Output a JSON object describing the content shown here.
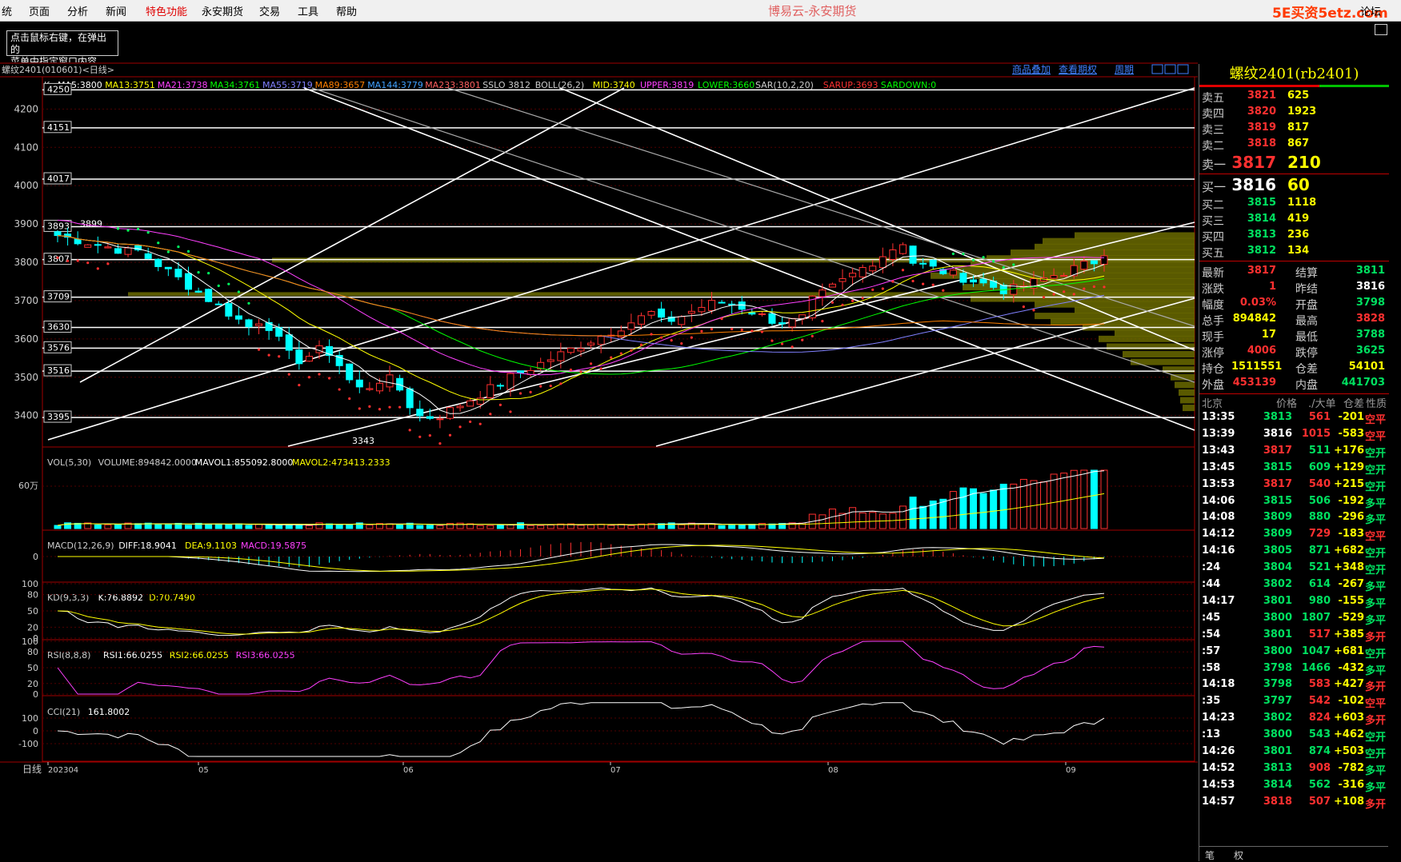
{
  "menu": {
    "items": [
      "统",
      "页面",
      "分析",
      "新闻",
      "特色功能",
      "永安期货",
      "交易",
      "工具",
      "帮助"
    ],
    "app_title": "博易云-永安期货",
    "logo_text": "5E买资5etz.com",
    "forum_text": "论坛"
  },
  "hint": {
    "line1": "点击鼠标右键，在弹出的",
    "line2": "菜单中指定窗口内容。"
  },
  "chart_header": {
    "symbol_label": "螺纹2401(010601)<日线>",
    "links": [
      "商品叠加",
      "查看期权",
      "周期"
    ],
    "indicator_prefix": "K",
    "indicators": [
      {
        "text": "MA5:3800",
        "color": "#ffffff"
      },
      {
        "text": "MA13:3751",
        "color": "#ffff00"
      },
      {
        "text": "MA21:3738",
        "color": "#ff40ff"
      },
      {
        "text": "MA34:3761",
        "color": "#00ff00"
      },
      {
        "text": "MA55:3719",
        "color": "#8080ff"
      },
      {
        "text": "MA89:3657",
        "color": "#ff8000"
      },
      {
        "text": "MA144:3779",
        "color": "#40a0ff"
      },
      {
        "text": "MA233:3801",
        "color": "#ff6060"
      },
      {
        "text": "SSLO 3812",
        "color": "#cccccc"
      },
      {
        "text": "BOLL(26,2)",
        "color": "#cccccc"
      },
      {
        "text": "MID:3740",
        "color": "#ffff00"
      },
      {
        "text": "UPPER:3819",
        "color": "#ff40ff"
      },
      {
        "text": "LOWER:3660",
        "color": "#00ff00"
      },
      {
        "text": "SAR(10,2,20)",
        "color": "#cccccc"
      },
      {
        "text": "SARUP:3693",
        "color": "#ff3030"
      },
      {
        "text": "SARDOWN:0",
        "color": "#00ff00"
      }
    ]
  },
  "sub_headers": {
    "vol": {
      "prefix": "VOL(5,30)",
      "items": [
        {
          "text": "VOLUME:894842.0000",
          "color": "#cccccc"
        },
        {
          "text": "MAVOL1:855092.8000",
          "color": "#ffffff"
        },
        {
          "text": "MAVOL2:473413.2333",
          "color": "#ffff00"
        }
      ]
    },
    "macd": {
      "prefix": "MACD(12,26,9)",
      "items": [
        {
          "text": "DIFF:18.9041",
          "color": "#ffffff"
        },
        {
          "text": "DEA:9.1103",
          "color": "#ffff00"
        },
        {
          "text": "MACD:19.5875",
          "color": "#ff40ff"
        }
      ]
    },
    "kd": {
      "prefix": "KD(9,3,3)",
      "items": [
        {
          "text": "K:76.8892",
          "color": "#ffffff"
        },
        {
          "text": "D:70.7490",
          "color": "#ffff00"
        }
      ]
    },
    "rsi": {
      "prefix": "RSI(8,8,8)",
      "items": [
        {
          "text": "RSI1:66.0255",
          "color": "#ffffff"
        },
        {
          "text": "RSI2:66.0255",
          "color": "#ffff00"
        },
        {
          "text": "RSI3:66.0255",
          "color": "#ff40ff"
        }
      ]
    },
    "cci": {
      "prefix": "CCI(21)",
      "items": [
        {
          "text": "161.8002",
          "color": "#ffffff"
        }
      ]
    }
  },
  "chart_data": {
    "type": "candlestick",
    "price_axis": {
      "ticks": [
        4200,
        4100,
        4000,
        3900,
        3800,
        3700,
        3600,
        3500,
        3400
      ],
      "range": [
        3320,
        4280
      ]
    },
    "horizontal_levels": [
      4250,
      4151,
      4017,
      3893,
      3807,
      3709,
      3630,
      3576,
      3516,
      3395
    ],
    "annotations": [
      {
        "text": "3899",
        "value": 3899
      },
      {
        "text": "3343",
        "value": 3343
      }
    ],
    "volume_axis": {
      "ticks": [
        "60万"
      ]
    },
    "macd_axis": {
      "ticks": [
        "0"
      ]
    },
    "kd_axis": {
      "ticks": [
        "100",
        "80",
        "50",
        "20",
        "0"
      ]
    },
    "rsi_axis": {
      "ticks": [
        "100",
        "80",
        "50",
        "20",
        "0"
      ]
    },
    "cci_axis": {
      "ticks": [
        "100",
        "0",
        "-100"
      ]
    },
    "time_axis": {
      "left_label": "日线",
      "ticks": [
        "202304",
        "05",
        "06",
        "07",
        "08",
        "09"
      ]
    },
    "latest": {
      "close": 3817,
      "volume": 894842
    }
  },
  "quote": {
    "title": "螺纹2401(rb2401)",
    "asks": [
      {
        "label": "卖五",
        "price": "3821",
        "vol": "625"
      },
      {
        "label": "卖四",
        "price": "3820",
        "vol": "1923"
      },
      {
        "label": "卖三",
        "price": "3819",
        "vol": "817"
      },
      {
        "label": "卖二",
        "price": "3818",
        "vol": "867"
      },
      {
        "label": "卖一",
        "price": "3817",
        "vol": "210"
      }
    ],
    "bids": [
      {
        "label": "买一",
        "price": "3816",
        "vol": "60"
      },
      {
        "label": "买二",
        "price": "3815",
        "vol": "1118"
      },
      {
        "label": "买三",
        "price": "3814",
        "vol": "419"
      },
      {
        "label": "买四",
        "price": "3813",
        "vol": "236"
      },
      {
        "label": "买五",
        "price": "3812",
        "vol": "134"
      }
    ],
    "stats": [
      {
        "l1": "最新",
        "v1": "3817",
        "c1": "red",
        "l2": "结算",
        "v2": "3811",
        "c2": "green"
      },
      {
        "l1": "涨跌",
        "v1": "1",
        "c1": "red",
        "l2": "昨结",
        "v2": "3816",
        "c2": "white"
      },
      {
        "l1": "幅度",
        "v1": "0.03%",
        "c1": "red",
        "l2": "开盘",
        "v2": "3798",
        "c2": "green"
      },
      {
        "l1": "总手",
        "v1": "894842",
        "c1": "yellow",
        "l2": "最高",
        "v2": "3828",
        "c2": "red"
      },
      {
        "l1": "现手",
        "v1": "17",
        "c1": "yellow",
        "l2": "最低",
        "v2": "3788",
        "c2": "green"
      },
      {
        "l1": "涨停",
        "v1": "4006",
        "c1": "red",
        "l2": "跌停",
        "v2": "3625",
        "c2": "green"
      },
      {
        "l1": "持仓",
        "v1": "1511551",
        "c1": "yellow",
        "l2": "仓差",
        "v2": "54101",
        "c2": "yellow"
      },
      {
        "l1": "外盘",
        "v1": "453139",
        "c1": "red",
        "l2": "内盘",
        "v2": "441703",
        "c2": "green"
      }
    ],
    "tick_header": {
      "place": "北京",
      "price": "价格",
      "vol": "./大单",
      "oi": "仓差",
      "nature": "性质"
    },
    "ticks": [
      {
        "t": "13:35",
        "p": "3813",
        "pc": "green",
        "v": "561",
        "vc": "red",
        "d": "-201",
        "dc": "yellow",
        "n": "空平",
        "nc": "red"
      },
      {
        "t": "13:39",
        "p": "3816",
        "pc": "white",
        "v": "1015",
        "vc": "red",
        "d": "-583",
        "dc": "yellow",
        "n": "空平",
        "nc": "red"
      },
      {
        "t": "13:43",
        "p": "3817",
        "pc": "red",
        "v": "511",
        "vc": "green",
        "d": "+176",
        "dc": "yellow",
        "n": "空开",
        "nc": "green"
      },
      {
        "t": "13:45",
        "p": "3815",
        "pc": "green",
        "v": "609",
        "vc": "green",
        "d": "+129",
        "dc": "yellow",
        "n": "空开",
        "nc": "green"
      },
      {
        "t": "13:53",
        "p": "3817",
        "pc": "red",
        "v": "540",
        "vc": "red",
        "d": "+215",
        "dc": "yellow",
        "n": "空开",
        "nc": "green"
      },
      {
        "t": "14:06",
        "p": "3815",
        "pc": "green",
        "v": "506",
        "vc": "green",
        "d": "-192",
        "dc": "yellow",
        "n": "多平",
        "nc": "green"
      },
      {
        "t": "14:08",
        "p": "3809",
        "pc": "green",
        "v": "880",
        "vc": "green",
        "d": "-296",
        "dc": "yellow",
        "n": "多平",
        "nc": "green"
      },
      {
        "t": "14:12",
        "p": "3809",
        "pc": "green",
        "v": "729",
        "vc": "red",
        "d": "-183",
        "dc": "yellow",
        "n": "空平",
        "nc": "red"
      },
      {
        "t": "14:16",
        "p": "3805",
        "pc": "green",
        "v": "871",
        "vc": "green",
        "d": "+682",
        "dc": "yellow",
        "n": "空开",
        "nc": "green"
      },
      {
        "t": ":24",
        "p": "3804",
        "pc": "green",
        "v": "521",
        "vc": "green",
        "d": "+348",
        "dc": "yellow",
        "n": "空开",
        "nc": "green"
      },
      {
        "t": ":44",
        "p": "3802",
        "pc": "green",
        "v": "614",
        "vc": "green",
        "d": "-267",
        "dc": "yellow",
        "n": "多平",
        "nc": "green"
      },
      {
        "t": "14:17",
        "p": "3801",
        "pc": "green",
        "v": "980",
        "vc": "green",
        "d": "-155",
        "dc": "yellow",
        "n": "多平",
        "nc": "green"
      },
      {
        "t": ":45",
        "p": "3800",
        "pc": "green",
        "v": "1807",
        "vc": "green",
        "d": "-529",
        "dc": "yellow",
        "n": "多平",
        "nc": "green"
      },
      {
        "t": ":54",
        "p": "3801",
        "pc": "green",
        "v": "517",
        "vc": "red",
        "d": "+385",
        "dc": "yellow",
        "n": "多开",
        "nc": "red"
      },
      {
        "t": ":57",
        "p": "3800",
        "pc": "green",
        "v": "1047",
        "vc": "green",
        "d": "+681",
        "dc": "yellow",
        "n": "空开",
        "nc": "green"
      },
      {
        "t": ":58",
        "p": "3798",
        "pc": "green",
        "v": "1466",
        "vc": "green",
        "d": "-432",
        "dc": "yellow",
        "n": "多平",
        "nc": "green"
      },
      {
        "t": "14:18",
        "p": "3798",
        "pc": "green",
        "v": "583",
        "vc": "red",
        "d": "+427",
        "dc": "yellow",
        "n": "多开",
        "nc": "red"
      },
      {
        "t": ":35",
        "p": "3797",
        "pc": "green",
        "v": "542",
        "vc": "red",
        "d": "-102",
        "dc": "yellow",
        "n": "空平",
        "nc": "red"
      },
      {
        "t": "14:23",
        "p": "3802",
        "pc": "green",
        "v": "824",
        "vc": "red",
        "d": "+603",
        "dc": "yellow",
        "n": "多开",
        "nc": "red"
      },
      {
        "t": ":13",
        "p": "3800",
        "pc": "green",
        "v": "543",
        "vc": "green",
        "d": "+462",
        "dc": "yellow",
        "n": "空开",
        "nc": "green"
      },
      {
        "t": "14:26",
        "p": "3801",
        "pc": "green",
        "v": "874",
        "vc": "green",
        "d": "+503",
        "dc": "yellow",
        "n": "空开",
        "nc": "green"
      },
      {
        "t": "14:52",
        "p": "3813",
        "pc": "green",
        "v": "908",
        "vc": "red",
        "d": "-782",
        "dc": "yellow",
        "n": "多平",
        "nc": "green"
      },
      {
        "t": "14:53",
        "p": "3814",
        "pc": "green",
        "v": "562",
        "vc": "green",
        "d": "-316",
        "dc": "yellow",
        "n": "多平",
        "nc": "green"
      },
      {
        "t": "14:57",
        "p": "3818",
        "pc": "red",
        "v": "507",
        "vc": "red",
        "d": "+108",
        "dc": "yellow",
        "n": "多开",
        "nc": "red"
      }
    ],
    "bottom_tabs": [
      "笔",
      "权"
    ]
  }
}
